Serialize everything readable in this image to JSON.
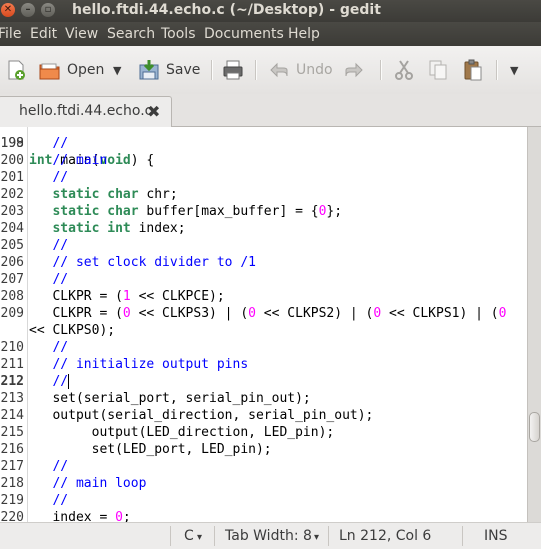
{
  "window": {
    "title": "hello.ftdi.44.echo.c (~/Desktop) - gedit",
    "controls": [
      "close-icon",
      "minimize-icon",
      "maximize-icon"
    ]
  },
  "menu": [
    "File",
    "Edit",
    "View",
    "Search",
    "Tools",
    "Documents",
    "Help"
  ],
  "toolbar": {
    "open_label": "Open",
    "save_label": "Save",
    "undo_label": "Undo",
    "icons": [
      "new-document-icon",
      "open-folder-icon",
      "dropdown-arrow-icon",
      "save-icon",
      "print-icon",
      "undo-icon",
      "redo-icon",
      "cut-icon",
      "copy-icon",
      "paste-icon",
      "overflow-arrow-icon"
    ]
  },
  "tabs": [
    {
      "label": "hello.ftdi.44.echo.c",
      "active": true
    }
  ],
  "editor": {
    "current_line": 212,
    "partial_top_line": "int main(void) {",
    "lines": [
      {
        "num": "199",
        "tokens": [
          [
            "c",
            "   //"
          ]
        ]
      },
      {
        "num": "200",
        "tokens": [
          [
            "c",
            "   // main"
          ]
        ]
      },
      {
        "num": "201",
        "tokens": [
          [
            "c",
            "   //"
          ]
        ]
      },
      {
        "num": "202",
        "tokens": [
          [
            "t",
            "   "
          ],
          [
            "k",
            "static char"
          ],
          [
            "t",
            " chr;"
          ]
        ]
      },
      {
        "num": "203",
        "tokens": [
          [
            "t",
            "   "
          ],
          [
            "k",
            "static char"
          ],
          [
            "t",
            " buffer[max_buffer] = {"
          ],
          [
            "n",
            "0"
          ],
          [
            "t",
            "};"
          ]
        ]
      },
      {
        "num": "204",
        "tokens": [
          [
            "t",
            "   "
          ],
          [
            "k",
            "static int"
          ],
          [
            "t",
            " index;"
          ]
        ]
      },
      {
        "num": "205",
        "tokens": [
          [
            "c",
            "   //"
          ]
        ]
      },
      {
        "num": "206",
        "tokens": [
          [
            "c",
            "   // set clock divider to /1"
          ]
        ]
      },
      {
        "num": "207",
        "tokens": [
          [
            "c",
            "   //"
          ]
        ]
      },
      {
        "num": "208",
        "tokens": [
          [
            "t",
            "   CLKPR = ("
          ],
          [
            "n",
            "1"
          ],
          [
            "t",
            " << CLKPCE);"
          ]
        ]
      },
      {
        "num": "209",
        "tokens": [
          [
            "t",
            "   CLKPR = ("
          ],
          [
            "n",
            "0"
          ],
          [
            "t",
            " << CLKPS3) | ("
          ],
          [
            "n",
            "0"
          ],
          [
            "t",
            " << CLKPS2) | ("
          ],
          [
            "n",
            "0"
          ],
          [
            "t",
            " << CLKPS1) | ("
          ],
          [
            "n",
            "0"
          ]
        ]
      },
      {
        "num": "",
        "tokens": [
          [
            "t",
            "<< CLKPS0);"
          ]
        ]
      },
      {
        "num": "210",
        "tokens": [
          [
            "c",
            "   //"
          ]
        ]
      },
      {
        "num": "211",
        "tokens": [
          [
            "c",
            "   // initialize output pins"
          ]
        ]
      },
      {
        "num": "212",
        "tokens": [
          [
            "c",
            "   //"
          ]
        ]
      },
      {
        "num": "213",
        "tokens": [
          [
            "t",
            "   set(serial_port, serial_pin_out);"
          ]
        ]
      },
      {
        "num": "214",
        "tokens": [
          [
            "t",
            "   output(serial_direction, serial_pin_out);"
          ]
        ]
      },
      {
        "num": "215",
        "tokens": [
          [
            "t",
            "        output(LED_direction, LED_pin);"
          ]
        ]
      },
      {
        "num": "216",
        "tokens": [
          [
            "t",
            "        set(LED_port, LED_pin);"
          ]
        ]
      },
      {
        "num": "217",
        "tokens": [
          [
            "c",
            "   //"
          ]
        ]
      },
      {
        "num": "218",
        "tokens": [
          [
            "c",
            "   // main loop"
          ]
        ]
      },
      {
        "num": "219",
        "tokens": [
          [
            "c",
            "   //"
          ]
        ]
      },
      {
        "num": "220",
        "tokens": [
          [
            "t",
            "   index = "
          ],
          [
            "n",
            "0"
          ],
          [
            "t",
            ";"
          ]
        ]
      }
    ],
    "scroll_fraction": 0.78
  },
  "statusbar": {
    "language": "C",
    "tab_width": "Tab Width:  8",
    "position": "Ln 212, Col 6",
    "mode": "INS"
  },
  "colors": {
    "comment": "#0000ff",
    "keyword": "#2e8b57",
    "number": "#ff00ff",
    "titlebar": "#3c3b37"
  }
}
